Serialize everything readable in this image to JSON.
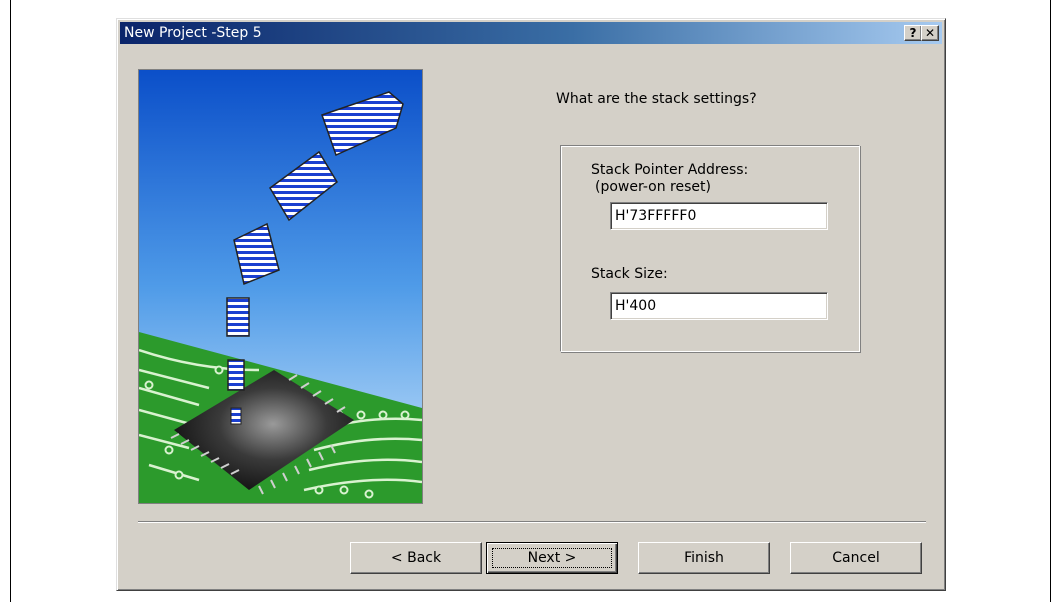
{
  "dialog": {
    "title": "New Project -Step 5",
    "help_button": "?",
    "close_button": "✕"
  },
  "prompt": "What are the stack settings?",
  "stack": {
    "pointer_label": "Stack Pointer Address:",
    "pointer_sublabel": "(power-on reset)",
    "pointer_value": "H'73FFFFF0",
    "size_label": "Stack Size:",
    "size_value": "H'400"
  },
  "buttons": {
    "back": "< Back",
    "next": "Next >",
    "finish": "Finish",
    "cancel": "Cancel"
  }
}
